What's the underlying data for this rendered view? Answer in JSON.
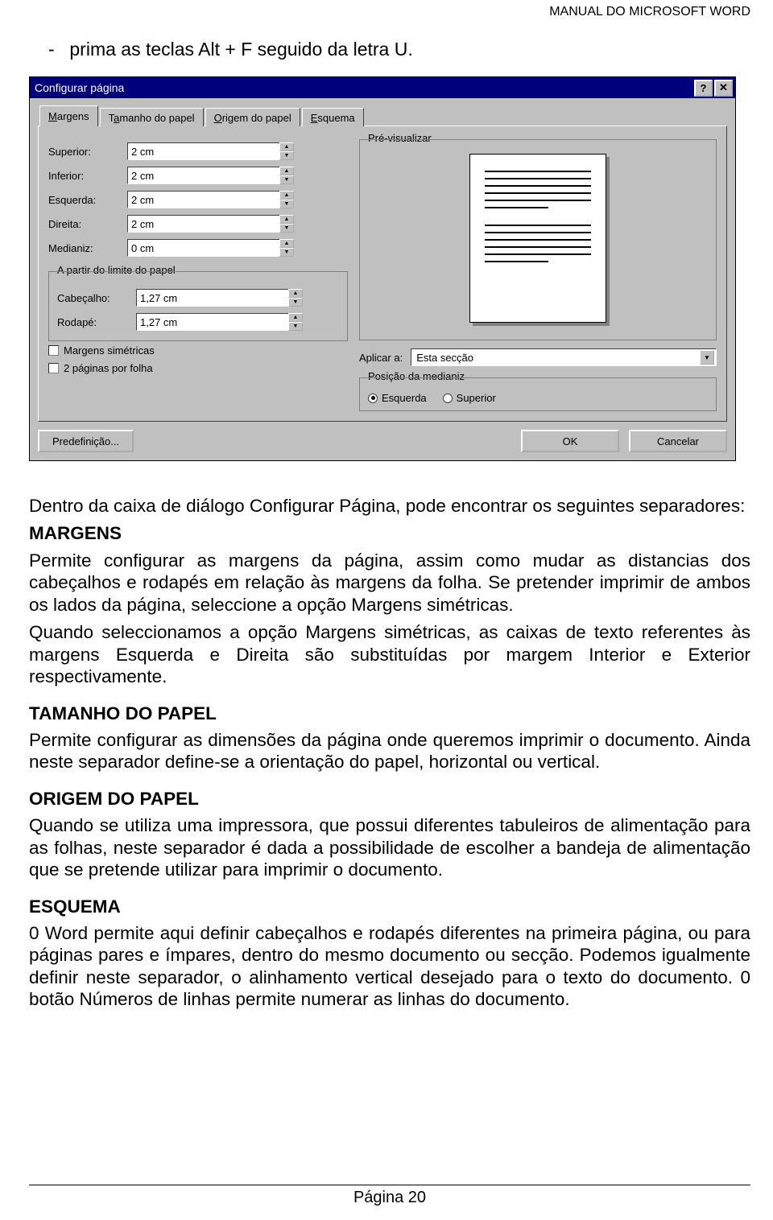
{
  "header": {
    "right": "MANUAL DO MICROSOFT WORD"
  },
  "bullet": {
    "dash": "-",
    "text": "prima as teclas Alt + F seguido da letra U."
  },
  "dialog": {
    "title": "Configurar página",
    "tabs": {
      "t1": "Margens",
      "t2_pre": "T",
      "t2_u": "a",
      "t2_post": "manho do papel",
      "t3_u": "O",
      "t3_post": "rigem do papel",
      "t4_u": "E",
      "t4_post": "squema"
    },
    "fields": {
      "superior": {
        "label": "Superior:",
        "value": "2 cm"
      },
      "inferior": {
        "label": "Inferior:",
        "value": "2 cm"
      },
      "esquerda": {
        "label": "Esquerda:",
        "value": "2 cm"
      },
      "direita": {
        "label": "Direita:",
        "value": "2 cm"
      },
      "medianiz": {
        "label": "Medianiz:",
        "value": "0 cm"
      }
    },
    "limite_title": "A partir do limite do papel",
    "limite": {
      "cabecalho": {
        "label": "Cabeçalho:",
        "value": "1,27 cm"
      },
      "rodape": {
        "label": "Rodapé:",
        "value": "1,27 cm"
      }
    },
    "chk1": "Margens simétricas",
    "chk2": "2 páginas por folha",
    "preview_title": "Pré-visualizar",
    "apply_label": "Aplicar a:",
    "apply_value": "Esta secção",
    "pos_med_title": "Posição da medianiz",
    "radio_esq": "Esquerda",
    "radio_sup": "Superior",
    "btn_pre": "Predefinição...",
    "btn_ok": "OK",
    "btn_cancel": "Cancelar"
  },
  "doc": {
    "intro": "Dentro da caixa de diálogo Configurar Página, pode encontrar os seguintes separadores:",
    "h_margens": "MARGENS",
    "p_margens1": "Permite configurar as margens da página, assim como mudar as distancias dos cabeçalhos e rodapés em relação às margens da folha. Se pretender imprimir de ambos os lados da página, seleccione a opção Margens simétricas.",
    "p_margens2": "Quando seleccionamos a opção Margens simétricas, as caixas de texto referentes às margens Esquerda e Direita são substituídas por margem Interior e Exterior respectivamente.",
    "h_tamanho": "TAMANHO DO PAPEL",
    "p_tamanho": "Permite configurar as dimensões da página onde queremos imprimir o documento. Ainda neste separador define-se a orientação do papel, horizontal ou vertical.",
    "h_origem": "ORIGEM DO PAPEL",
    "p_origem": "Quando se utiliza uma impressora, que possui diferentes tabuleiros de alimentação para as folhas, neste separador é dada a possibilidade de escolher a bandeja de alimentação que se pretende utilizar para imprimir o documento.",
    "h_esquema": "ESQUEMA",
    "p_esquema": "0 Word permite aqui definir cabeçalhos e rodapés diferentes na primeira página, ou para páginas pares e ímpares, dentro do mesmo documento ou secção. Podemos igualmente definir neste separador, o alinhamento vertical desejado para o texto do documento. 0 botão Números de linhas permite numerar as linhas do documento."
  },
  "footer": {
    "page": "Página 20"
  }
}
